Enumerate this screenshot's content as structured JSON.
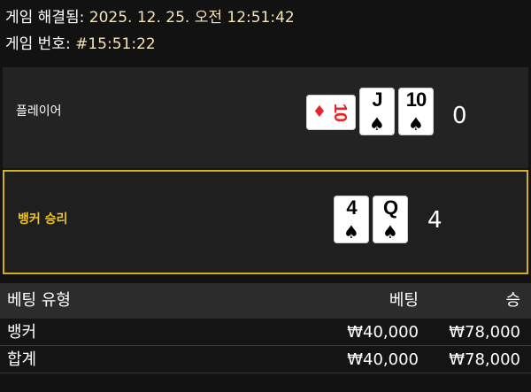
{
  "info": {
    "resolved_label": "게임 해결됨:",
    "resolved_value": "2025. 12. 25. 오전 12:51:42",
    "game_number_label": "게임 번호:",
    "game_number_value": "#15:51:22"
  },
  "player": {
    "label": "플레이어",
    "score": "0",
    "cards": [
      {
        "rank": "10",
        "suit": "♦",
        "color": "#e4262b",
        "orientation": "sideways"
      },
      {
        "rank": "J",
        "suit": "♠",
        "color": "#000000"
      },
      {
        "rank": "10",
        "suit": "♠",
        "color": "#000000"
      }
    ]
  },
  "banker": {
    "label": "뱅커 승리",
    "score": "4",
    "cards": [
      {
        "rank": "4",
        "suit": "♠",
        "color": "#000000"
      },
      {
        "rank": "Q",
        "suit": "♠",
        "color": "#000000"
      }
    ]
  },
  "bets": {
    "headers": {
      "type": "베팅 유형",
      "bet": "베팅",
      "win": "승"
    },
    "rows": [
      {
        "type": "뱅커",
        "bet": "₩40,000",
        "win": "₩78,000"
      }
    ],
    "total": {
      "type": "합계",
      "bet": "₩40,000",
      "win": "₩78,000"
    }
  },
  "colors": {
    "background": "#121212",
    "winner_accent": "#d4af1f",
    "info_value": "#f2e4b6"
  }
}
